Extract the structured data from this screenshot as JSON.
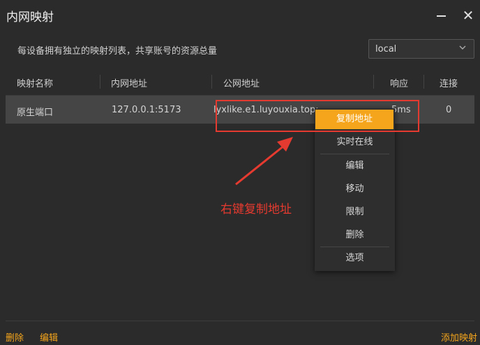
{
  "window": {
    "title": "内网映射",
    "minimize_icon": "minimize-icon",
    "close_icon": "close-icon"
  },
  "description": "每设备拥有独立的映射列表，共享账号的资源总量",
  "device_select": {
    "value": "local",
    "icon": "chevron-down-icon"
  },
  "table": {
    "headers": [
      "映射名称",
      "内网地址",
      "公网地址",
      "响应",
      "连接"
    ],
    "rows": [
      {
        "name": "原生端口",
        "local_address": "127.0.0.1:5173",
        "public_address": "lyxlike.e1.luyouxia.top:",
        "latency": "5ms",
        "connections": "0"
      }
    ]
  },
  "context_menu": {
    "items": [
      "复制地址",
      "实时在线",
      "编辑",
      "移动",
      "限制",
      "删除",
      "选项"
    ],
    "active_index": 0
  },
  "annotation": {
    "text": "右键复制地址",
    "color": "#e53a2f"
  },
  "footer": {
    "delete": "删除",
    "edit": "编辑",
    "add": "添加映射"
  },
  "colors": {
    "accent": "#f4a51c",
    "background": "#2b2b2b",
    "row_selected": "#454545"
  }
}
